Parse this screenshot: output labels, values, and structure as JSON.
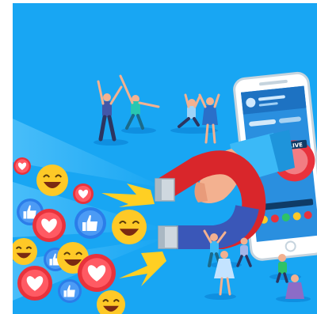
{
  "illustration": {
    "live_label": "LIVE",
    "colors": {
      "background": "#18a6f3",
      "background_dark": "#0f8fe0",
      "magnet_red": "#d9262b",
      "magnet_steel": "#cfd8df",
      "heart_red": "#e8323c",
      "emoji_yellow": "#fec927",
      "like_blue": "#2b7de9",
      "lightning": "#ffcf23",
      "skin": "#f3b190",
      "sleeve": "#3bb9f7",
      "phone_frame": "#ffffff",
      "phone_screen": "#2a8fdf"
    },
    "icons": [
      "heart-icon",
      "laughing-emoji-icon",
      "thumbs-up-icon",
      "magnet-icon",
      "lightning-icon",
      "hand-icon",
      "smartphone-icon",
      "dancing-people-icon"
    ]
  }
}
